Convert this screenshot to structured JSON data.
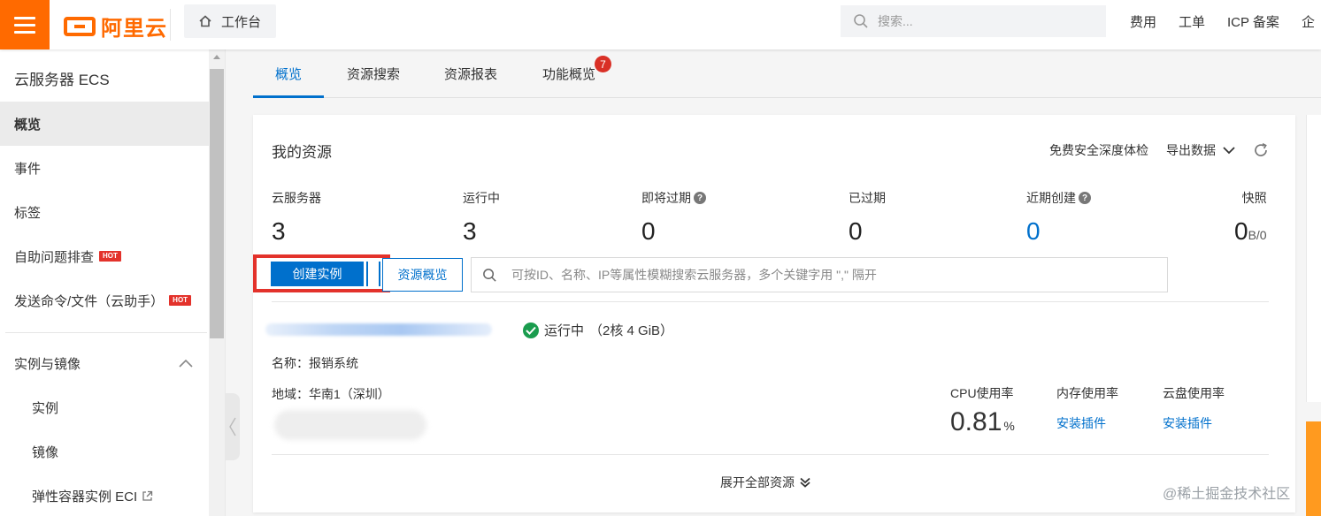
{
  "topbar": {
    "brand": "阿里云",
    "workbench": "工作台",
    "search_placeholder": "搜索...",
    "nav": [
      "费用",
      "工单",
      "ICP 备案",
      "企"
    ]
  },
  "sidebar": {
    "title": "云服务器 ECS",
    "items": [
      {
        "label": "概览",
        "active": true
      },
      {
        "label": "事件"
      },
      {
        "label": "标签"
      },
      {
        "label": "自助问题排查",
        "badge": "HOT"
      },
      {
        "label": "发送命令/文件（云助手）",
        "badge": "HOT"
      }
    ],
    "group": "实例与镜像",
    "subitems": [
      "实例",
      "镜像",
      "弹性容器实例 ECI"
    ]
  },
  "tabs": [
    {
      "label": "概览",
      "active": true
    },
    {
      "label": "资源搜索"
    },
    {
      "label": "资源报表"
    },
    {
      "label": "功能概览",
      "badge": "7"
    }
  ],
  "card": {
    "title": "我的资源",
    "actions": {
      "security_check": "免费安全深度体检",
      "export": "导出数据"
    },
    "stats": [
      {
        "label": "云服务器",
        "value": "3"
      },
      {
        "label": "运行中",
        "value": "3"
      },
      {
        "label": "即将过期",
        "value": "0",
        "help": "?"
      },
      {
        "label": "已过期",
        "value": "0"
      },
      {
        "label": "近期创建",
        "value": "0",
        "help": "?"
      },
      {
        "label": "快照",
        "value": "0",
        "unit": "B/0"
      }
    ],
    "create_button": "创建实例",
    "overview_button": "资源概览",
    "search_placeholder": "可按ID、名称、IP等属性模糊搜索云服务器，多个关键字用 \",\" 隔开",
    "instance": {
      "status": "运行中",
      "spec": "（2核 4 GiB）",
      "name_label": "名称：",
      "name": "报销系统",
      "region_label": "地域：",
      "region": "华南1（深圳）"
    },
    "metrics": {
      "cpu_label": "CPU使用率",
      "cpu_value": "0.81",
      "cpu_unit": "%",
      "mem_label": "内存使用率",
      "mem_action": "安装插件",
      "disk_label": "云盘使用率",
      "disk_action": "安装插件"
    },
    "expand": "展开全部资源"
  },
  "watermark": "@稀土掘金技术社区",
  "colors": {
    "brand": "#ff6a00",
    "primary": "#0070cc",
    "success": "#1a9c4e",
    "hot": "#e3322b"
  }
}
